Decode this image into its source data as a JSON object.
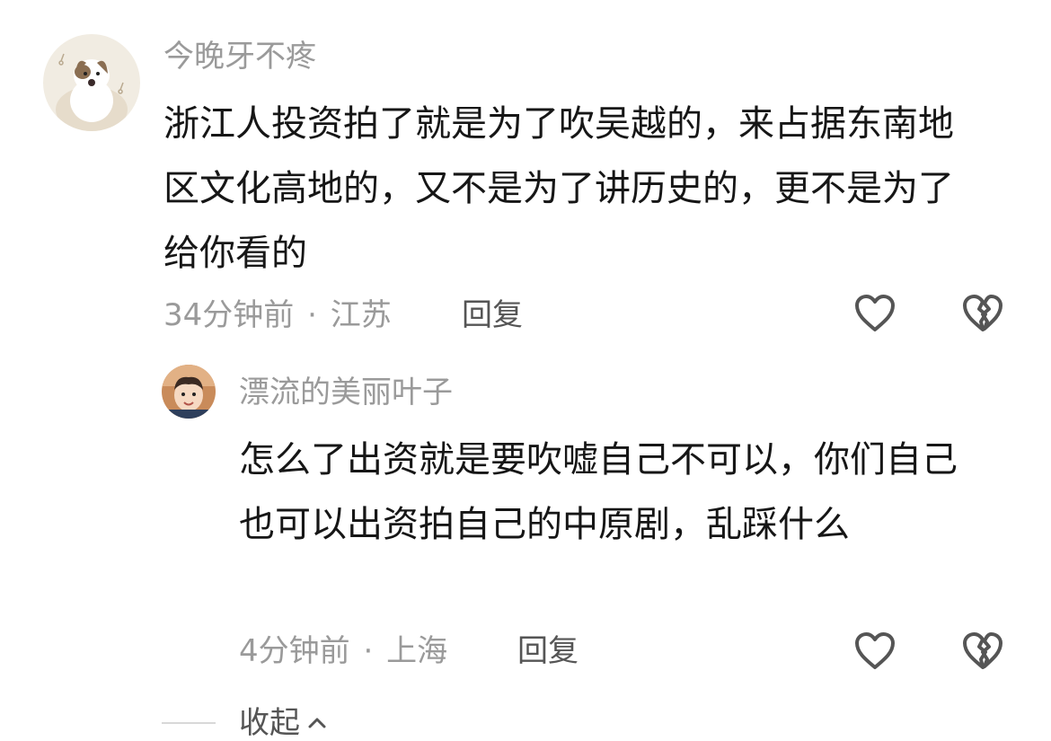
{
  "comments": [
    {
      "username": "今晚牙不疼",
      "text": "浙江人投资拍了就是为了吹吴越的，来占据东南地区文化高地的，又不是为了讲历史的，更不是为了给你看的",
      "time": "34分钟前",
      "separator": "·",
      "location": "江苏",
      "reply_label": "回复",
      "like_icon": "heart-outline-icon",
      "dislike_icon": "broken-heart-icon"
    },
    {
      "username": "漂流的美丽叶子",
      "text": "怎么了出资就是要吹嘘自己不可以，你们自己也可以出资拍自己的中原剧，乱踩什么",
      "time": "4分钟前",
      "separator": "·",
      "location": "上海",
      "reply_label": "回复",
      "like_icon": "heart-outline-icon",
      "dislike_icon": "broken-heart-icon"
    }
  ],
  "collapse": {
    "label": "收起",
    "icon": "chevron-up-icon"
  },
  "colors": {
    "secondary_text": "#9a9a9a",
    "primary_text": "#161616",
    "icon_stroke": "#555555"
  }
}
